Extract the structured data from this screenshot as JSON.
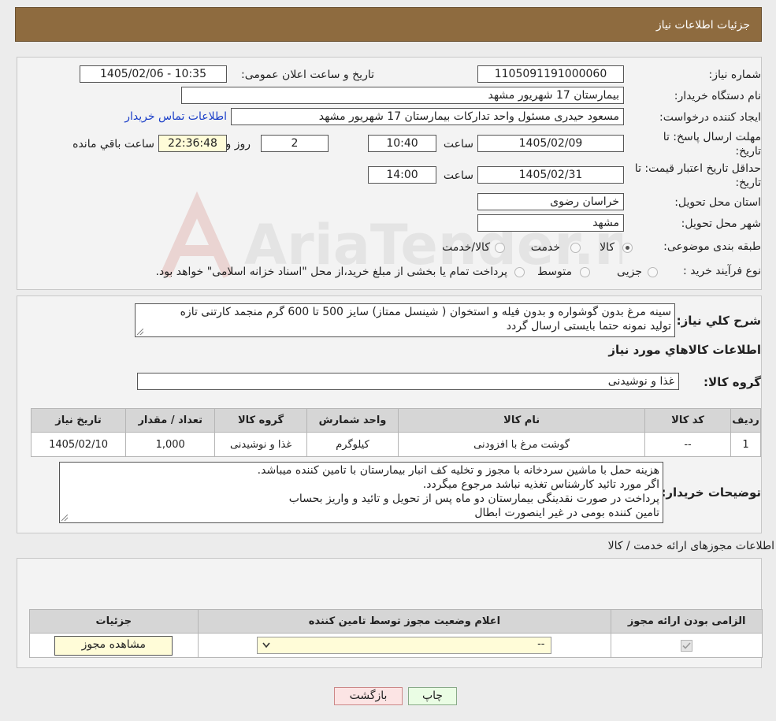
{
  "header": {
    "title": "جزئیات اطلاعات نیاز"
  },
  "form": {
    "need_number_label": "شماره نیاز:",
    "need_number": "1105091191000060",
    "announce_label": "تاریخ و ساعت اعلان عمومی:",
    "announce_value": "1405/02/06 - 10:35",
    "buyer_org_label": "نام دستگاه خریدار:",
    "buyer_org": "بیمارستان 17 شهریور مشهد",
    "creator_label": "ایجاد کننده درخواست:",
    "creator": "مسعود حیدری مسئول واحد تدارکات  بیمارستان 17 شهریور مشهد",
    "contact_link": "اطلاعات تماس خریدار",
    "deadline_label_1": "مهلت ارسال پاسخ: تا",
    "deadline_label_2": "تاریخ:",
    "deadline_date": "1405/02/09",
    "time_label": "ساعت",
    "deadline_time": "10:40",
    "days_value": "2",
    "days_label": "روز و",
    "remaining_time": "22:36:48",
    "remaining_label": "ساعت باقي مانده",
    "validity_label_1": "حداقل تاریخ اعتبار قیمت: تا",
    "validity_label_2": "تاریخ:",
    "validity_date": "1405/02/31",
    "validity_time": "14:00",
    "province_label": "استان محل تحویل:",
    "province": "خراسان رضوی",
    "city_label": "شهر محل تحویل:",
    "city": "مشهد",
    "category_label": "طبقه بندی موضوعی:",
    "category_options": [
      "کالا",
      "خدمت",
      "کالا/خدمت"
    ],
    "category_selected": "کالا",
    "process_label": "نوع فرآیند خرید :",
    "process_options": [
      "جزیی",
      "متوسط"
    ],
    "process_note": "پرداخت تمام یا بخشی از مبلغ خرید،از محل \"اسناد خزانه اسلامی\" خواهد بود."
  },
  "description": {
    "label": "شرح کلي نياز:",
    "lines": [
      "سینه مرغ بدون گوشواره و بدون  فیله و استخوان ( شینسل ممتاز) سایز 500 تا 600 گرم منجمد کارتنی تازه",
      "تولید نمونه حتما بایستی ارسال گردد"
    ]
  },
  "goods": {
    "section_title": "اطلاعات کالاهاي مورد نياز",
    "group_label": "گروه کالا:",
    "group_value": "غذا و نوشیدنی",
    "columns": [
      "رديف",
      "کد کالا",
      "نام کالا",
      "واحد شمارش",
      "گروه کالا",
      "تعداد / مقدار",
      "تاريخ نياز"
    ],
    "rows": [
      [
        "1",
        "--",
        "گوشت مرغ با افزودنی",
        "کیلوگرم",
        "غذا و نوشیدنی",
        "1,000",
        "1405/02/10"
      ]
    ]
  },
  "buyer_notes": {
    "label": "توضیحات خریدار:",
    "lines": [
      "هزینه حمل با ماشین سردخانه با مجوز و تخلیه کف انبار بیمارستان با تامین کننده میباشد.",
      "اگر مورد تائید کارشناس تغذیه نباشد مرجوع میگردد.",
      "پرداخت در صورت نقدینگی بیمارستان دو ماه پس از تحویل و تائید و واریز بحساب",
      "تامین کننده بومی در غیر اینصورت ابطال"
    ]
  },
  "permits": {
    "section_title": "اطلاعات مجوزهای ارائه خدمت / کالا",
    "columns": [
      "الزامی بودن ارائه مجوز",
      "اعلام وضعیت مجوز توسط تامین کننده",
      "جزئیات"
    ],
    "select_value": "--",
    "view_button": "مشاهده مجوز"
  },
  "footer": {
    "print_button": "چاپ",
    "back_button": "بازگشت"
  },
  "watermark": {
    "text": "AriaTender.neT"
  }
}
